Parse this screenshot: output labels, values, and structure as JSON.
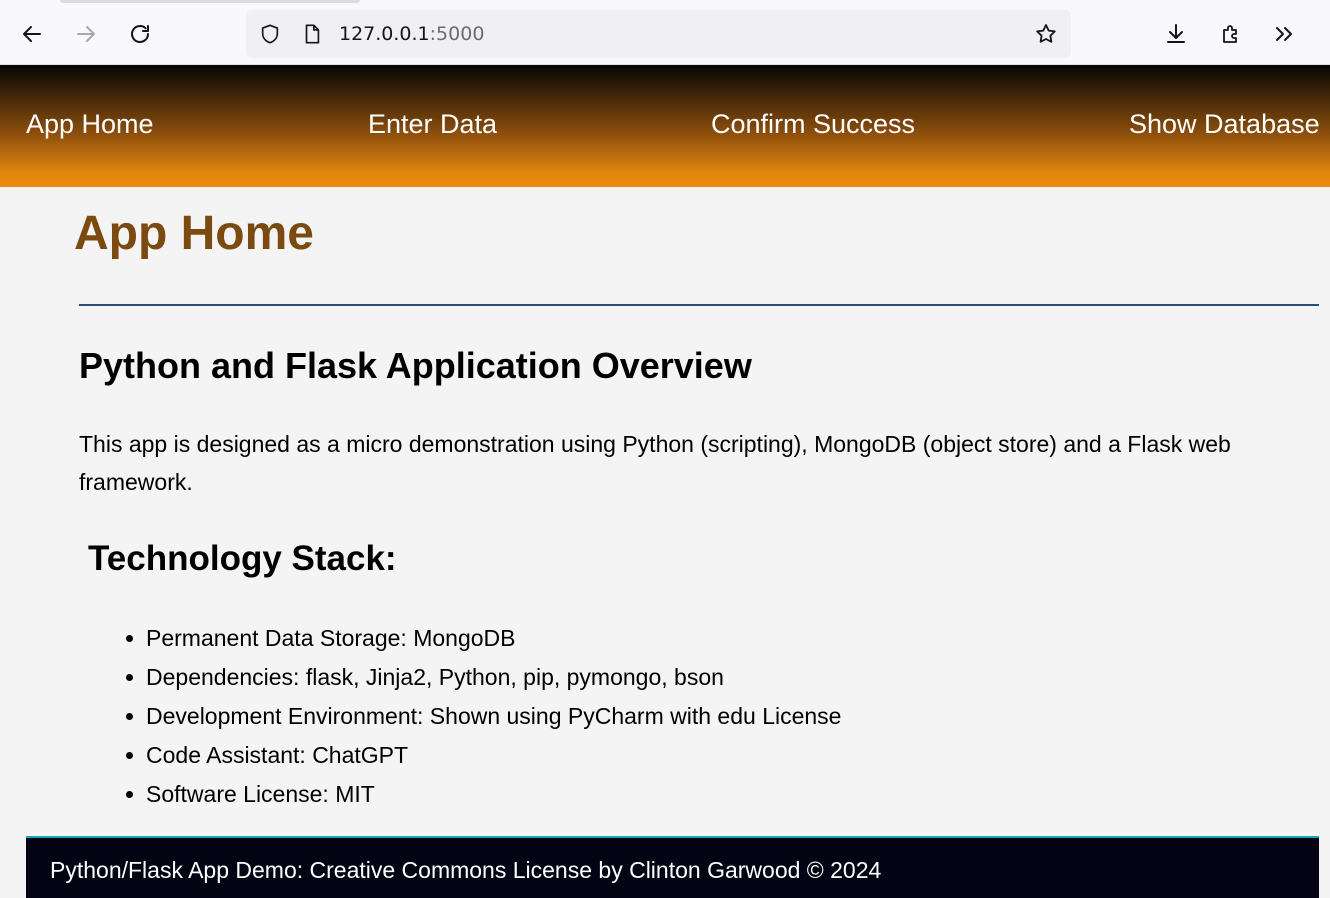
{
  "browser": {
    "url_host": "127.0.0.1",
    "url_port": ":5000",
    "icons": [
      "back-icon",
      "forward-icon",
      "reload-icon",
      "shield-icon",
      "page-icon",
      "star-icon",
      "download-icon",
      "extensions-icon",
      "overflow-icon"
    ]
  },
  "nav": {
    "items": [
      {
        "label": "App Home"
      },
      {
        "label": "Enter Data"
      },
      {
        "label": "Confirm Success"
      },
      {
        "label": "Show Database"
      }
    ]
  },
  "main": {
    "title": "App Home",
    "section_title": "Python and Flask Application Overview",
    "intro": "This app is designed as a micro demonstration using Python (scripting), MongoDB (object store) and a Flask web framework.",
    "stack_title": "Technology Stack:",
    "stack_items": [
      "Permanent Data Storage: MongoDB",
      "Dependencies: flask, Jinja2, Python, pip, pymongo, bson",
      "Development Environment: Shown using PyCharm with edu License",
      "Code Assistant: ChatGPT",
      "Software License: MIT"
    ]
  },
  "footer": {
    "text": "Python/Flask App Demo: Creative Commons License by Clinton Garwood © 2024"
  },
  "colors": {
    "title": "#7a4a11",
    "nav_gradient_end": "#ee8c0e",
    "divider": "#2d4f75",
    "footer_bg": "#030314",
    "footer_border": "#1aa6b7"
  }
}
